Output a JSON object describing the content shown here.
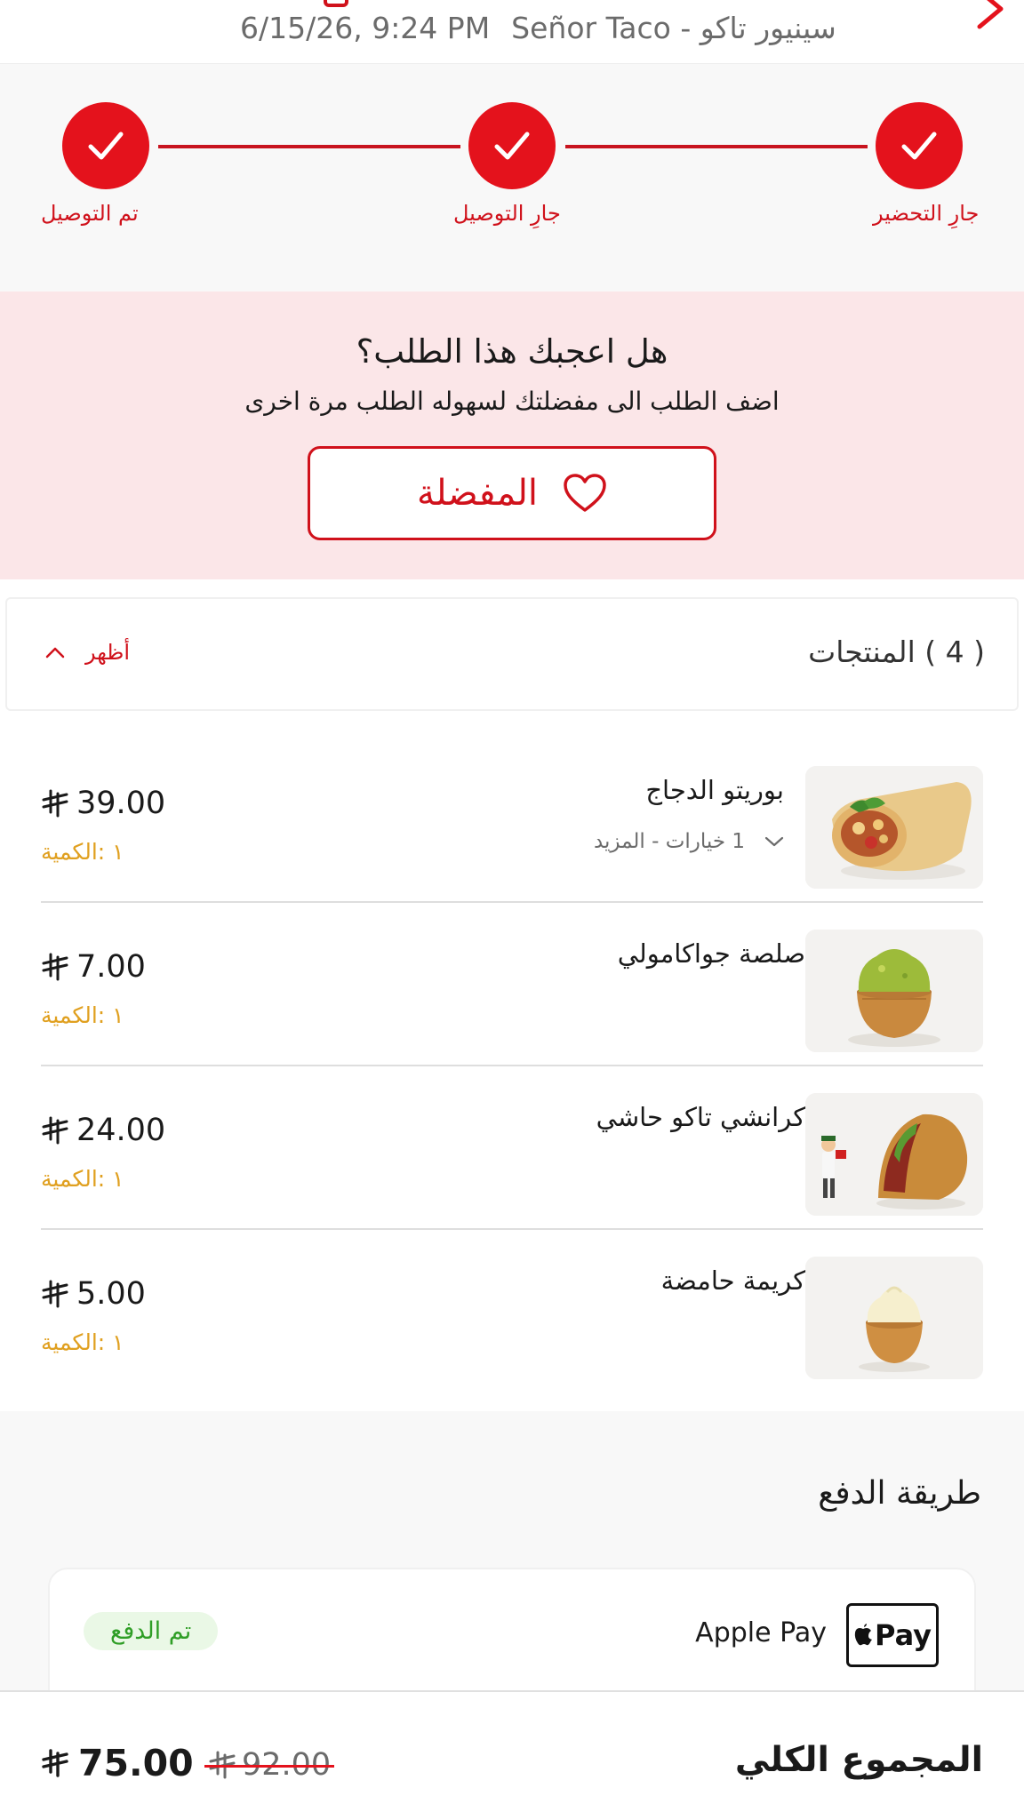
{
  "header": {
    "datetime": "6/15/26, 9:24 PM",
    "restaurant": "Señor Taco - سينيور تاكو"
  },
  "progress": {
    "steps": [
      {
        "label": "جارِ التحضير",
        "done": true
      },
      {
        "label": "جارِ التوصيل",
        "done": true
      },
      {
        "label": "تم التوصيل",
        "done": true
      }
    ]
  },
  "favorite_promo": {
    "title": "هل اعجبك هذا الطلب؟",
    "subtitle": "اضف الطلب الى مفضلتك لسهوله الطلب مرة اخرى",
    "button_label": "المفضلة"
  },
  "products": {
    "title": "( 4 ) المنتجات",
    "toggle_label": "أظهر",
    "items": [
      {
        "name": "بوريتو الدجاج",
        "options": "1 خيارات - المزيد",
        "price": "39.00",
        "qty": "١ :الكمية",
        "image": "burrito"
      },
      {
        "name": "صلصة جواكامولي",
        "price": "7.00",
        "qty": "١ :الكمية",
        "image": "guacamole"
      },
      {
        "name": "كرانشي تاكو حاشي",
        "price": "24.00",
        "qty": "١ :الكمية",
        "image": "taco"
      },
      {
        "name": "كريمة حامضة",
        "price": "5.00",
        "qty": "١ :الكمية",
        "image": "sour-cream"
      }
    ]
  },
  "payment": {
    "title": "طريقة الدفع",
    "method": "Apple Pay",
    "logo_text": "Pay",
    "status": "تم الدفع"
  },
  "total": {
    "label": "المجموع الكلي",
    "new_amount": "75.00",
    "old_amount": "92.00"
  },
  "colors": {
    "accent": "#e4121c",
    "promo_bg": "#fbe6e8",
    "qty": "#e0a020",
    "paid": "#2f9e26"
  }
}
